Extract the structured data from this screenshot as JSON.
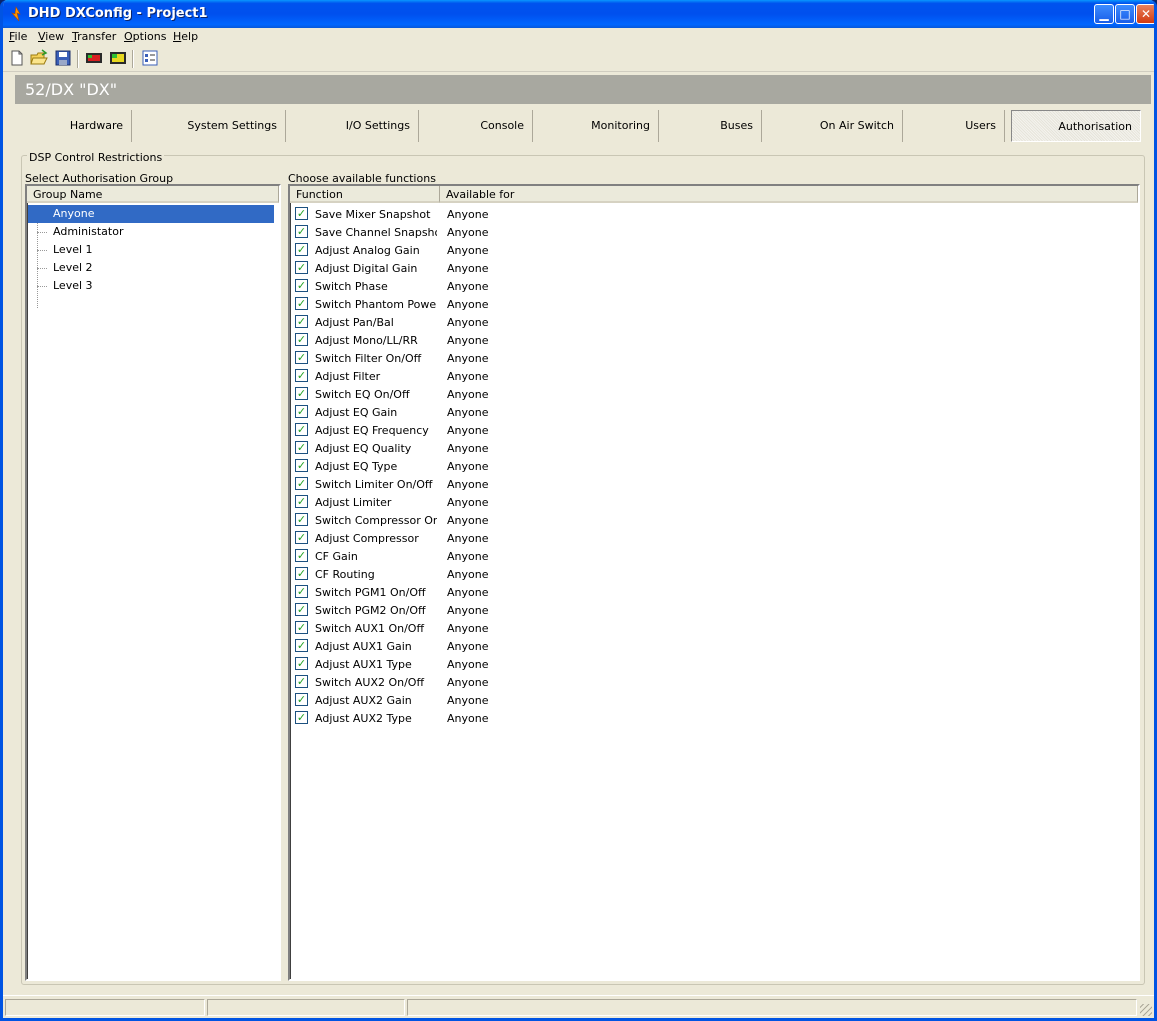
{
  "window": {
    "title": "DHD DXConfig - Project1"
  },
  "menu": [
    {
      "accel": "F",
      "rest": "ile"
    },
    {
      "accel": "V",
      "rest": "iew"
    },
    {
      "accel": "T",
      "rest": "ransfer"
    },
    {
      "accel": "O",
      "rest": "ptions"
    },
    {
      "accel": "H",
      "rest": "elp"
    }
  ],
  "toolbar": [
    "new-file-icon",
    "open-folder-icon",
    "save-disk-icon",
    "device-red-icon",
    "device-yellow-icon",
    "properties-icon"
  ],
  "device_header": "52/DX \"DX\"",
  "tabs": [
    "Hardware",
    "System Settings",
    "I/O Settings",
    "Console",
    "Monitoring",
    "Buses",
    "On Air Switch",
    "Users",
    "Authorisation"
  ],
  "active_tab": "Authorisation",
  "groupbox_label": "DSP Control Restrictions",
  "groups_panel": {
    "label": "Select Authorisation Group",
    "column": "Group Name",
    "items": [
      "Anyone",
      "Administator",
      "Level 1",
      "Level 2",
      "Level 3"
    ],
    "selected": "Anyone"
  },
  "functions_panel": {
    "label": "Choose available functions",
    "columns": [
      "Function",
      "Available for"
    ],
    "rows": [
      {
        "name": "Save Mixer Snapshot",
        "available": "Anyone",
        "checked": true
      },
      {
        "name": "Save Channel Snapshot",
        "available": "Anyone",
        "checked": true
      },
      {
        "name": "Adjust Analog Gain",
        "available": "Anyone",
        "checked": true
      },
      {
        "name": "Adjust Digital Gain",
        "available": "Anyone",
        "checked": true
      },
      {
        "name": "Switch Phase",
        "available": "Anyone",
        "checked": true
      },
      {
        "name": "Switch Phantom Power",
        "available": "Anyone",
        "checked": true
      },
      {
        "name": "Adjust Pan/Bal",
        "available": "Anyone",
        "checked": true
      },
      {
        "name": "Adjust Mono/LL/RR",
        "available": "Anyone",
        "checked": true
      },
      {
        "name": "Switch Filter On/Off",
        "available": "Anyone",
        "checked": true
      },
      {
        "name": "Adjust Filter",
        "available": "Anyone",
        "checked": true
      },
      {
        "name": "Switch EQ On/Off",
        "available": "Anyone",
        "checked": true
      },
      {
        "name": "Adjust EQ Gain",
        "available": "Anyone",
        "checked": true
      },
      {
        "name": "Adjust EQ Frequency",
        "available": "Anyone",
        "checked": true
      },
      {
        "name": "Adjust EQ Quality",
        "available": "Anyone",
        "checked": true
      },
      {
        "name": "Adjust EQ Type",
        "available": "Anyone",
        "checked": true
      },
      {
        "name": "Switch Limiter On/Off",
        "available": "Anyone",
        "checked": true
      },
      {
        "name": "Adjust Limiter",
        "available": "Anyone",
        "checked": true
      },
      {
        "name": "Switch Compressor On...",
        "available": "Anyone",
        "checked": true
      },
      {
        "name": "Adjust Compressor",
        "available": "Anyone",
        "checked": true
      },
      {
        "name": "CF Gain",
        "available": "Anyone",
        "checked": true
      },
      {
        "name": "CF Routing",
        "available": "Anyone",
        "checked": true
      },
      {
        "name": "Switch PGM1 On/Off",
        "available": "Anyone",
        "checked": true
      },
      {
        "name": "Switch PGM2 On/Off",
        "available": "Anyone",
        "checked": true
      },
      {
        "name": "Switch AUX1 On/Off",
        "available": "Anyone",
        "checked": true
      },
      {
        "name": "Adjust AUX1 Gain",
        "available": "Anyone",
        "checked": true
      },
      {
        "name": "Adjust AUX1 Type",
        "available": "Anyone",
        "checked": true
      },
      {
        "name": "Switch AUX2 On/Off",
        "available": "Anyone",
        "checked": true
      },
      {
        "name": "Adjust AUX2 Gain",
        "available": "Anyone",
        "checked": true
      },
      {
        "name": "Adjust AUX2 Type",
        "available": "Anyone",
        "checked": true
      }
    ]
  },
  "colors": {
    "titlebar": "#0054e3",
    "selection": "#316ac5",
    "header_band": "#a8a8a0",
    "check": "#21a121"
  }
}
